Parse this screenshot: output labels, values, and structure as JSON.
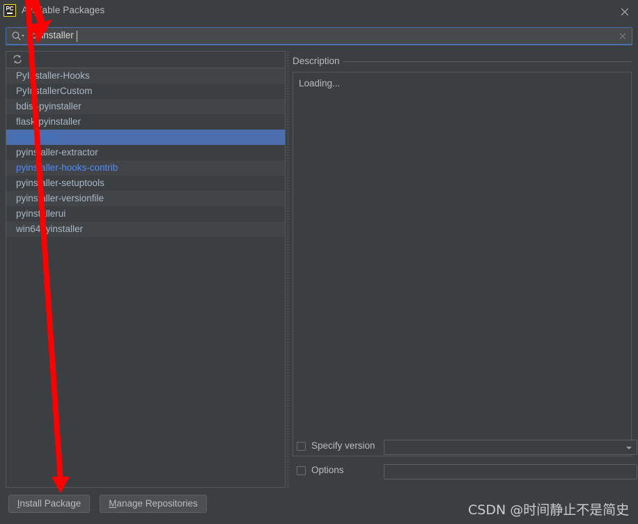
{
  "window": {
    "title": "Available Packages",
    "icon": "pycharm-icon",
    "close_icon": "close-icon"
  },
  "search": {
    "value": "pyinstaller",
    "placeholder": "",
    "icon": "search-icon",
    "clear_icon": "clear-icon"
  },
  "list": {
    "refresh_icon": "refresh-icon",
    "selected_index": 4,
    "items": [
      {
        "name": "PyInstaller-Hooks",
        "link": false
      },
      {
        "name": "PyInstallerCustom",
        "link": false
      },
      {
        "name": "bdist-pyinstaller",
        "link": false
      },
      {
        "name": "flask-pyinstaller",
        "link": false
      },
      {
        "name": "pyinstaller",
        "link": true
      },
      {
        "name": "pyinstaller-extractor",
        "link": false
      },
      {
        "name": "pyinstaller-hooks-contrib",
        "link": true
      },
      {
        "name": "pyinstaller-setuptools",
        "link": false
      },
      {
        "name": "pyinstaller-versionfile",
        "link": false
      },
      {
        "name": "pyinstallerui",
        "link": false
      },
      {
        "name": "win64pyinstaller",
        "link": false
      }
    ]
  },
  "description": {
    "header": "Description",
    "body": "Loading..."
  },
  "options": {
    "specify_version": {
      "label": "Specify version",
      "checked": false,
      "value": ""
    },
    "extra_options": {
      "label": "Options",
      "checked": false,
      "value": ""
    }
  },
  "buttons": {
    "install": {
      "mnemonic": "I",
      "rest": "nstall Package"
    },
    "manage": {
      "mnemonic": "M",
      "rest": "anage Repositories"
    }
  },
  "watermark": "CSDN @时间静止不是简史",
  "colors": {
    "background": "#3c3f41",
    "selection": "#4b6eaf",
    "link": "#548af7",
    "accent_border": "#4b6eaf",
    "annotation": "#fe0000",
    "text": "#bbbbbb"
  }
}
